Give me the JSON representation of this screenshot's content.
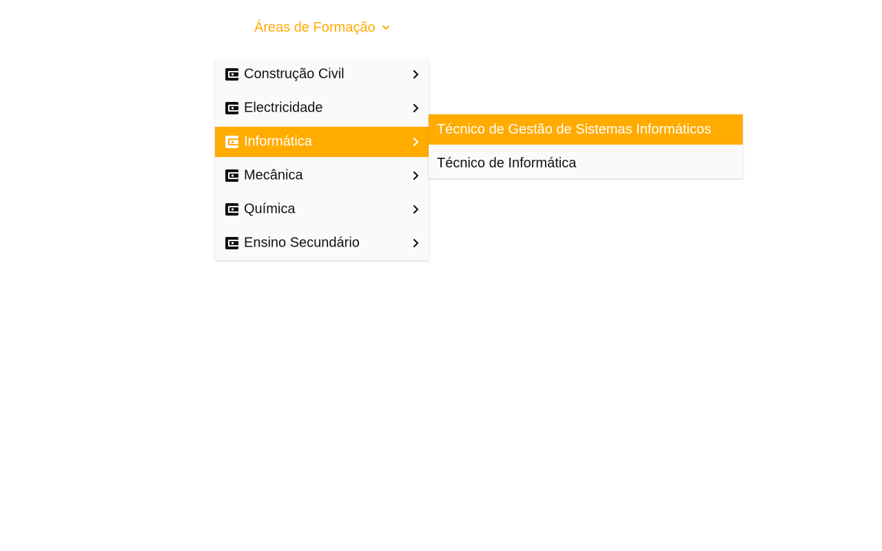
{
  "nav": {
    "trigger_label": "Áreas de Formação",
    "trigger_icon": "chevron-down-icon",
    "accent_color": "#FFAB00"
  },
  "menu": {
    "items": [
      {
        "label": "Construção Civil",
        "icon": "wallet-icon",
        "active": false
      },
      {
        "label": "Electricidade",
        "icon": "wallet-icon",
        "active": false
      },
      {
        "label": "Informática",
        "icon": "wallet-icon",
        "active": true
      },
      {
        "label": "Mecânica",
        "icon": "wallet-icon",
        "active": false
      },
      {
        "label": "Química",
        "icon": "wallet-icon",
        "active": false
      },
      {
        "label": "Ensino Secundário",
        "icon": "wallet-icon",
        "active": false
      }
    ]
  },
  "submenu": {
    "items": [
      {
        "label": "Técnico de Gestão de Sistemas Informáticos",
        "active": true
      },
      {
        "label": "Técnico de Informática",
        "active": false
      }
    ]
  }
}
